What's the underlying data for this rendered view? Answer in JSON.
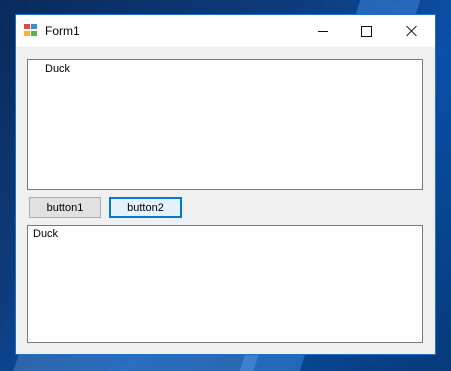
{
  "window": {
    "title": "Form1",
    "icon": "winforms-app-icon"
  },
  "caption_buttons": {
    "minimize": "minimize-icon",
    "maximize": "maximize-icon",
    "close": "close-icon"
  },
  "listbox": {
    "items": [
      "Duck"
    ]
  },
  "buttons": {
    "button1_label": "button1",
    "button2_label": "button2"
  },
  "textbox": {
    "value": "Duck"
  },
  "colors": {
    "accent": "#0078d7",
    "window_background": "#f0f0f0",
    "desktop": "#0d3b7a"
  }
}
